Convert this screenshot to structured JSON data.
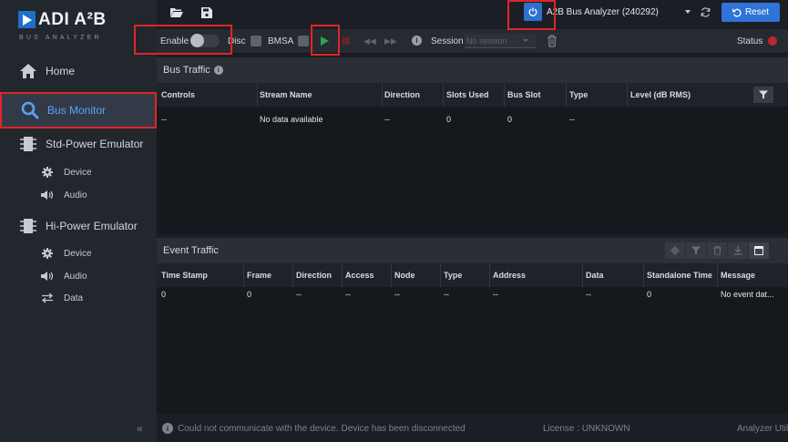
{
  "logo": {
    "name": "ADI A²B",
    "subtitle": "BUS ANALYZER"
  },
  "sidebar": {
    "items": [
      {
        "label": "Home",
        "icon": "home-icon"
      },
      {
        "label": "Bus Monitor",
        "icon": "search-icon",
        "active": true
      },
      {
        "label": "Std-Power Emulator",
        "icon": "chip-icon",
        "children": [
          {
            "label": "Device",
            "icon": "gear-icon"
          },
          {
            "label": "Audio",
            "icon": "speaker-icon"
          }
        ]
      },
      {
        "label": "Hi-Power Emulator",
        "icon": "chip-icon",
        "children": [
          {
            "label": "Device",
            "icon": "gear-icon"
          },
          {
            "label": "Audio",
            "icon": "speaker-icon"
          },
          {
            "label": "Data",
            "icon": "arrows-icon"
          }
        ]
      }
    ]
  },
  "topbar": {
    "device": "A2B Bus Analyzer (240292)",
    "reset_label": "Reset",
    "icons": [
      "folder-open-icon",
      "save-icon",
      "power-icon",
      "refresh-icon"
    ]
  },
  "toolbar": {
    "enable_label": "Enable",
    "enable_on": false,
    "disc_label": "Disc",
    "bmsa_label": "BMSA",
    "session_label": "Session",
    "session_placeholder": "No session",
    "status_label": "Status",
    "status_color": "#c0272d"
  },
  "bus_traffic": {
    "title": "Bus Traffic",
    "columns": [
      "Controls",
      "Stream Name",
      "Direction",
      "Slots Used",
      "Bus Slot",
      "Type",
      "Level (dB RMS)"
    ],
    "rows": [
      [
        "--",
        "No data available",
        "--",
        "0",
        "0",
        "--",
        ""
      ]
    ]
  },
  "event_traffic": {
    "title": "Event Traffic",
    "columns": [
      "Time Stamp",
      "Frame",
      "Direction",
      "Access",
      "Node",
      "Type",
      "Address",
      "Data",
      "Standalone Time",
      "Message"
    ],
    "rows": [
      [
        "0",
        "0",
        "--",
        "--",
        "--",
        "--",
        "--",
        "--",
        "0",
        "No event dat..."
      ]
    ]
  },
  "footer": {
    "message": "Could not communicate with the device. Device has been disconnected",
    "license": "License : UNKNOWN",
    "right": "Analyzer Util"
  },
  "colors": {
    "accent": "#2f74d6",
    "highlight": "#e0242a",
    "play": "#2ea44f"
  }
}
